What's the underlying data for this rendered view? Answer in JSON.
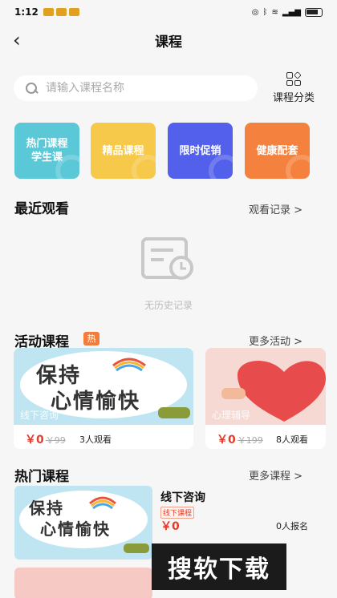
{
  "status": {
    "time": "1:12"
  },
  "header": {
    "title": "课程"
  },
  "search": {
    "placeholder": "请输入课程名称"
  },
  "category": {
    "label": "课程分类"
  },
  "features": [
    {
      "label": "热门课程学生课",
      "line1": "热门课程",
      "line2": "学生课",
      "color": "#5bc8d8"
    },
    {
      "label": "精品课程",
      "color": "#f6c94a"
    },
    {
      "label": "限时促销",
      "color": "#5260ec"
    },
    {
      "label": "健康配套",
      "color": "#f4823e"
    }
  ],
  "recent": {
    "title": "最近观看",
    "more": "观看记录 >",
    "empty_text": "无历史记录"
  },
  "activity": {
    "title": "活动课程",
    "badge": "热",
    "more": "更多活动 >",
    "cards": [
      {
        "image_text_line1": "保持",
        "image_text_line2": "心情愉快",
        "caption": "线下咨询",
        "price": "￥0",
        "original_price": "￥99",
        "views": "3人观看"
      },
      {
        "caption": "心理辅导",
        "price": "￥0",
        "original_price": "￥199",
        "views": "8人观看"
      }
    ]
  },
  "hot": {
    "title": "热门课程",
    "more": "更多课程 >",
    "items": [
      {
        "image_text_line1": "保持",
        "image_text_line2": "心情愉快",
        "title": "线下咨询",
        "tag": "线下课程",
        "price": "￥0",
        "enroll": "0人报名"
      }
    ]
  },
  "watermark": "搜软下载"
}
